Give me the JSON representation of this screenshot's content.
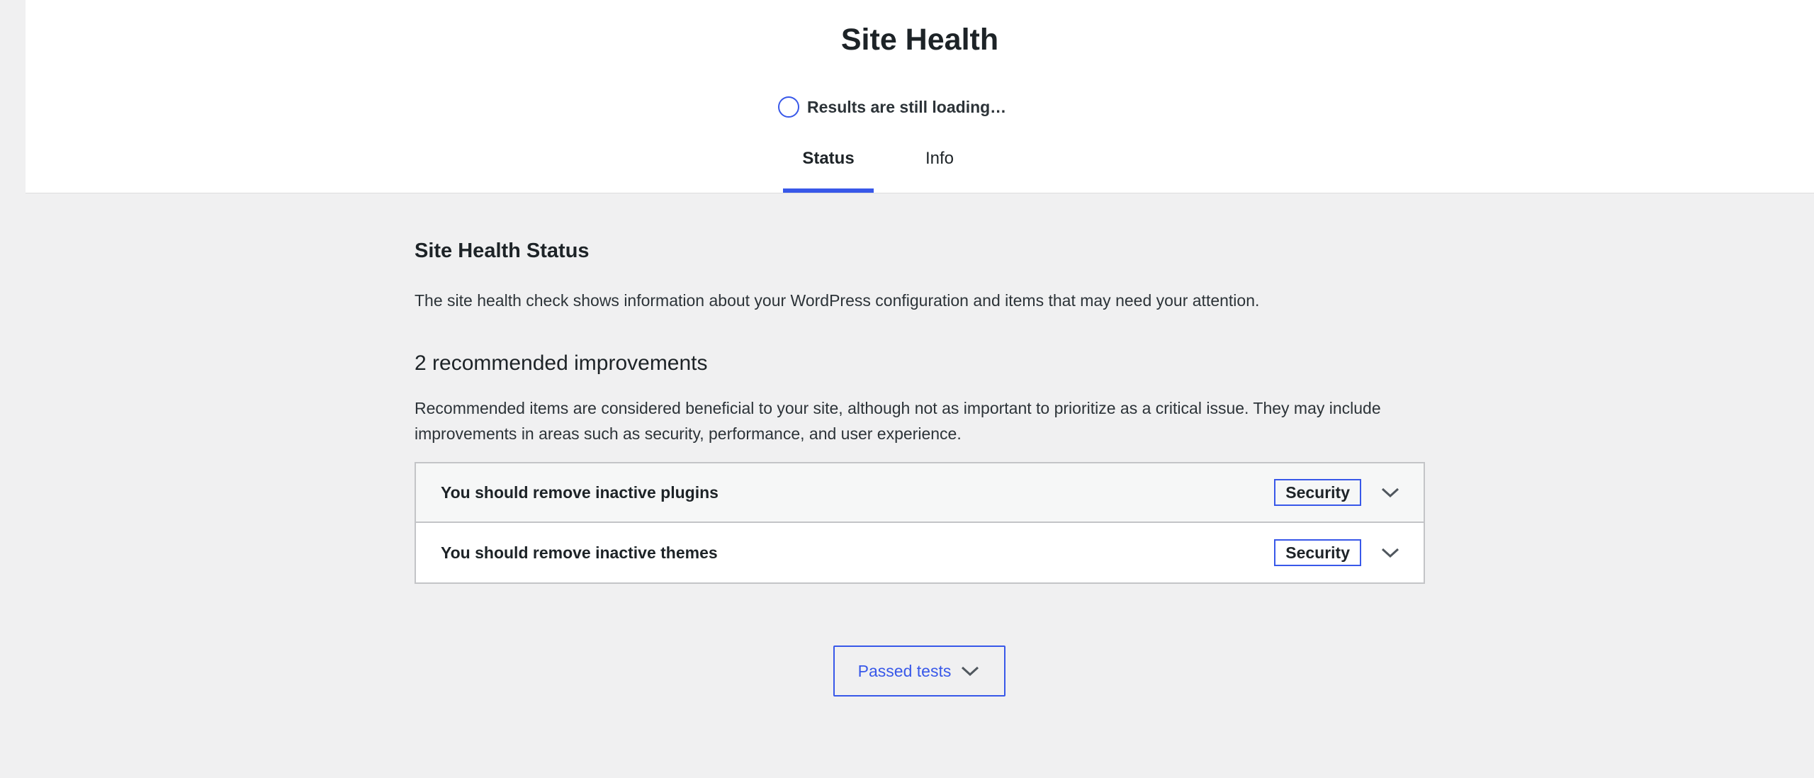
{
  "header": {
    "title": "Site Health",
    "loading_text": "Results are still loading…"
  },
  "tabs": [
    {
      "label": "Status",
      "active": true
    },
    {
      "label": "Info",
      "active": false
    }
  ],
  "status": {
    "title": "Site Health Status",
    "description": "The site health check shows information about your WordPress configuration and items that may need your attention."
  },
  "improvements": {
    "title": "2 recommended improvements",
    "description": "Recommended items are considered beneficial to your site, although not as important to prioritize as a critical issue. They may include improvements in areas such as security, performance, and user experience.",
    "items": [
      {
        "label": "You should remove inactive plugins",
        "badge": "Security"
      },
      {
        "label": "You should remove inactive themes",
        "badge": "Security"
      }
    ]
  },
  "passed_tests": {
    "label": "Passed tests"
  },
  "colors": {
    "accent": "#3858e9",
    "background": "#f0f0f1",
    "header_bg": "#ffffff"
  },
  "icons": {
    "loading": "loading-ring-icon",
    "expand": "chevron-down-icon"
  }
}
